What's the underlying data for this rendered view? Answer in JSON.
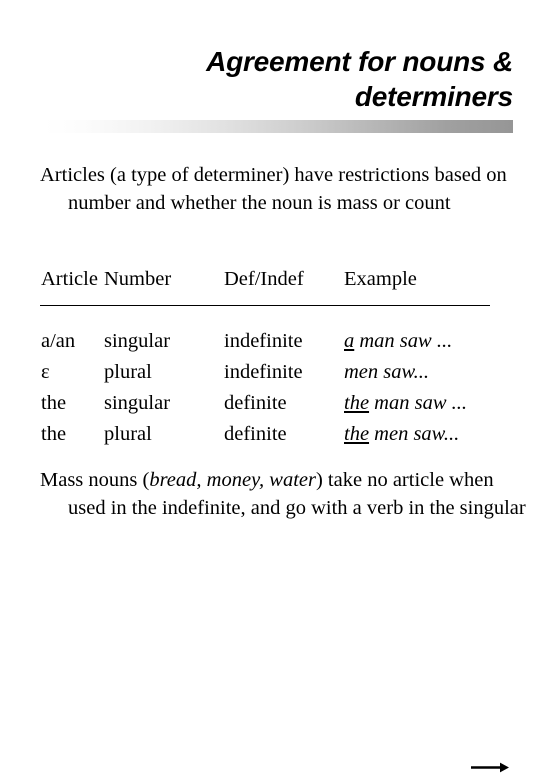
{
  "slide": {
    "title_lines": [
      "Agreement for nouns &",
      "determiners"
    ],
    "intro_paragraph": "Articles (a type of determiner) have restrictions based on number and whether the noun is mass or count",
    "mass_noun_paragraph": {
      "before": "Mass nouns (",
      "italic": "bread, money, water",
      "after": ") take no article when used in the indefinite, and go with a verb in the singular"
    }
  },
  "table": {
    "headers": [
      "Article",
      "Number",
      "Def/Indef",
      "Example"
    ],
    "rows": [
      {
        "article": "a/an",
        "number": "singular",
        "defindef": "indefinite",
        "example_article": "a",
        "example_rest": " man saw ..."
      },
      {
        "article": "ε",
        "number": "plural",
        "defindef": "indefinite",
        "example_article": " ",
        "example_rest": " men saw..."
      },
      {
        "article": "the",
        "number": "singular",
        "defindef": "definite",
        "example_article": "the",
        "example_rest": " man saw ..."
      },
      {
        "article": "the",
        "number": "plural",
        "defindef": "definite",
        "example_article": "the",
        "example_rest": " men saw..."
      }
    ]
  },
  "navigation": {
    "next_arrow_label": "next-slide-arrow"
  },
  "colors": {
    "text": "#000000",
    "background": "#ffffff",
    "rule_gradient_start": "#ffffff",
    "rule_gradient_end": "#969696"
  }
}
